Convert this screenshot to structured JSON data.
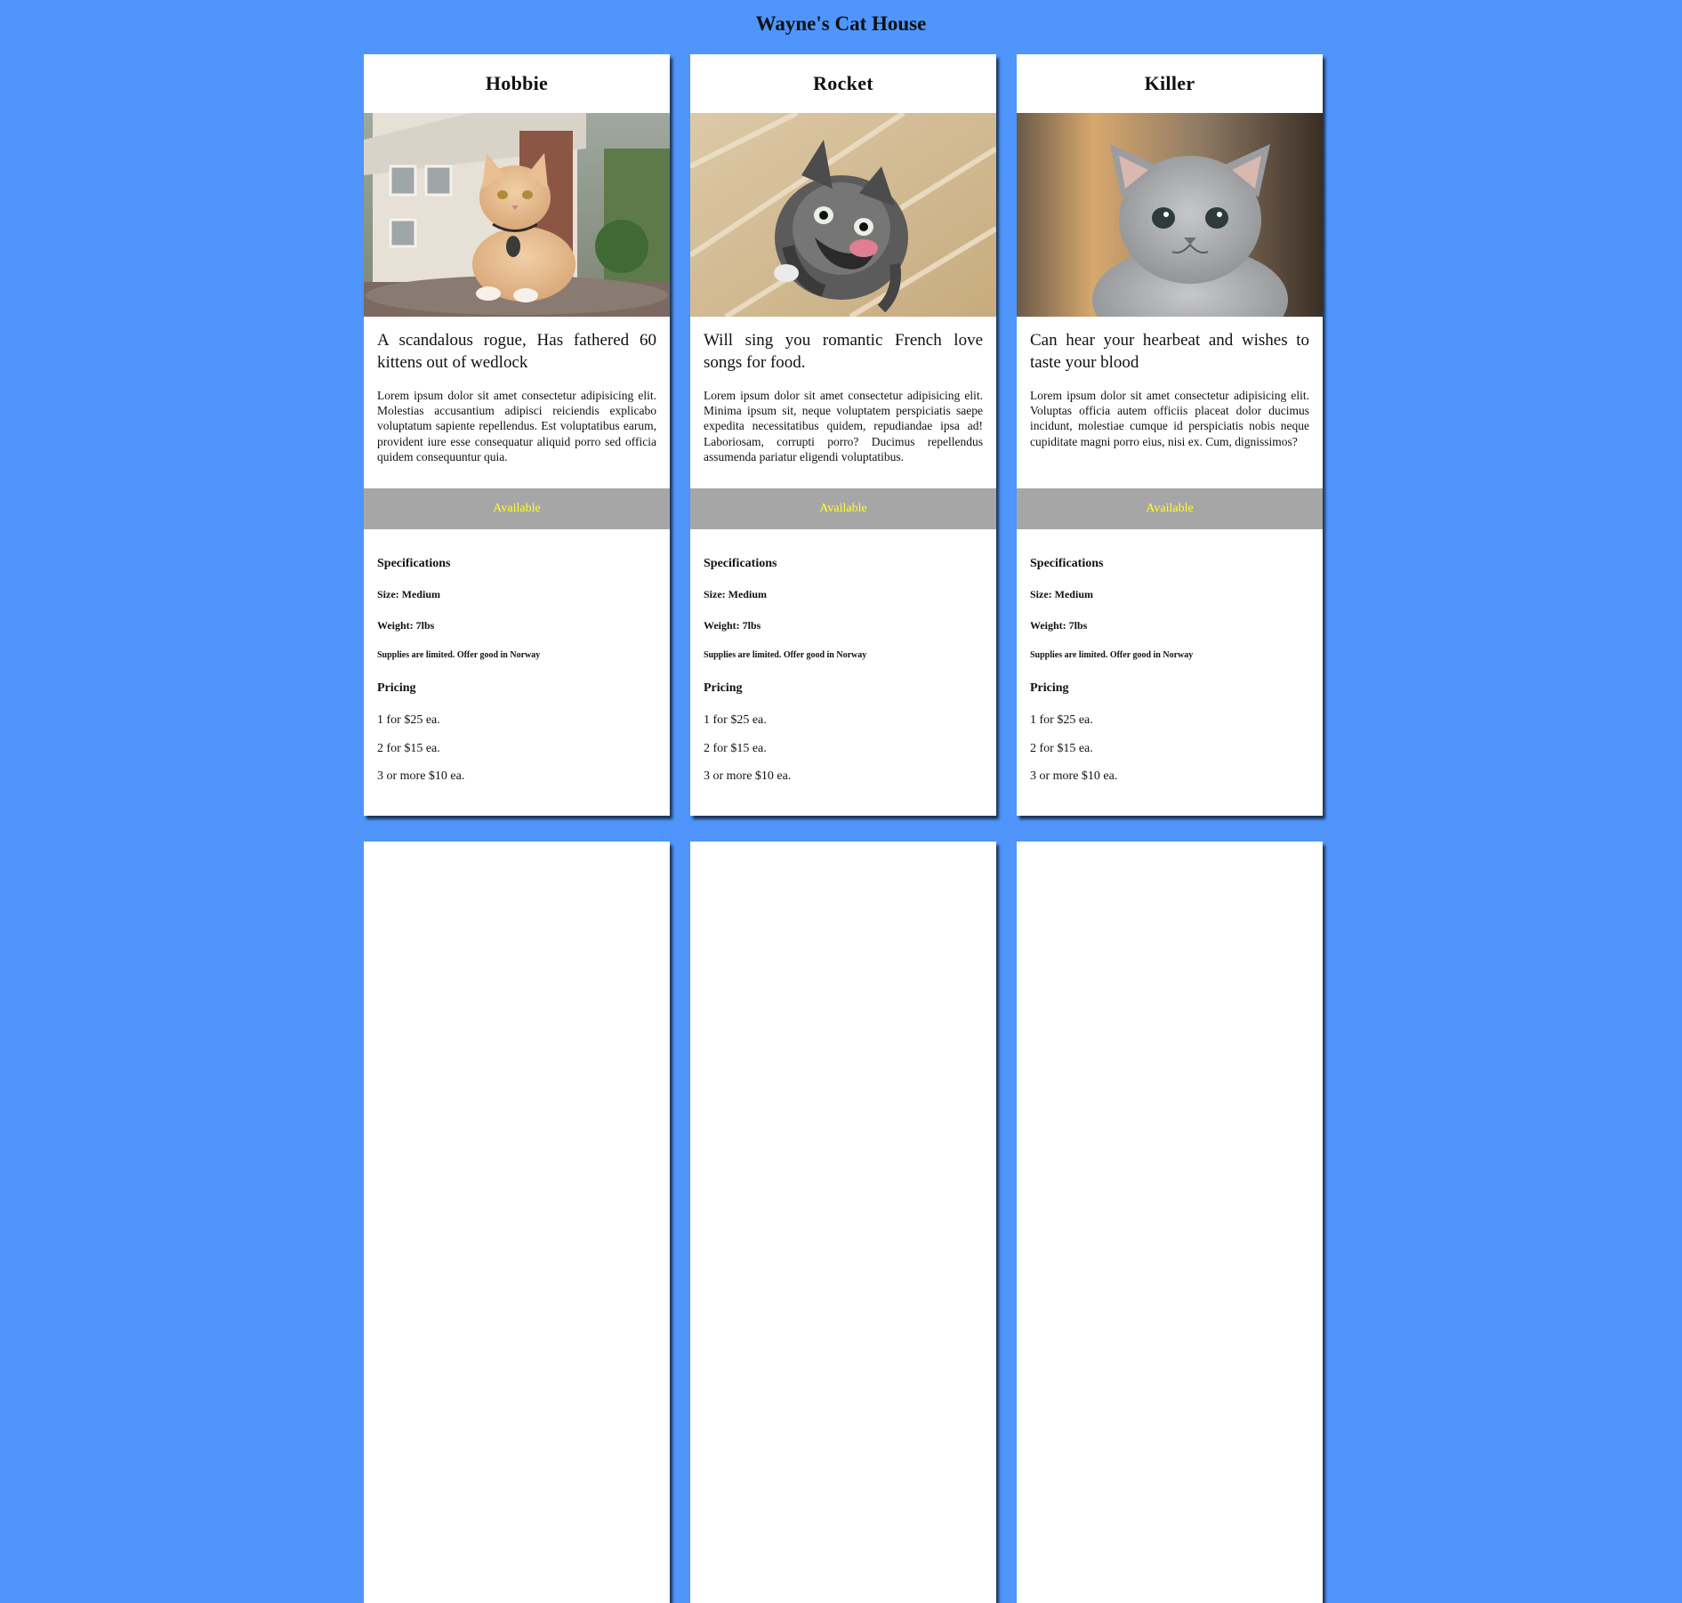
{
  "site": {
    "title": "Wayne's Cat House"
  },
  "labels": {
    "specifications": "Specifications",
    "pricing": "Pricing",
    "note": "Supplies are limited. Offer good in Norway"
  },
  "cats": [
    {
      "name": "Hobbie",
      "photo": "orange-tabby-cat-photo",
      "tagline": "A scandalous rogue, Has fathered 60 kittens out of wedlock",
      "blurb": "Lorem ipsum dolor sit amet consectetur adipisicing elit. Molestias accusantium adipisci reiciendis explicabo voluptatum sapiente repellendus. Est voluptatibus earum, provident iure esse consequatur aliquid porro sed officia quidem consequuntur quia.",
      "status": "Available",
      "size": "Size: Medium",
      "weight": "Weight: 7lbs",
      "prices": [
        "1 for $25 ea.",
        "2 for $15 ea.",
        "3 or more $10 ea."
      ]
    },
    {
      "name": "Rocket",
      "photo": "tabby-kitten-tongue-photo",
      "tagline": "Will sing you romantic French love songs for food.",
      "blurb": "Lorem ipsum dolor sit amet consectetur adipisicing elit. Minima ipsum sit, neque voluptatem perspiciatis saepe expedita necessitatibus quidem, repudiandae ipsa ad! Laboriosam, corrupti porro? Ducimus repellendus assumenda pariatur eligendi voluptatibus.",
      "status": "Available",
      "size": "Size: Medium",
      "weight": "Weight: 7lbs",
      "prices": [
        "1 for $25 ea.",
        "2 for $15 ea.",
        "3 or more $10 ea."
      ]
    },
    {
      "name": "Killer",
      "photo": "grey-kitten-photo",
      "tagline": "Can hear your hearbeat and wishes to taste your blood",
      "blurb": "Lorem ipsum dolor sit amet consectetur adipisicing elit. Voluptas officia autem officiis placeat dolor ducimus incidunt, molestiae cumque id perspiciatis nobis neque cupiditate magni porro eius, nisi ex. Cum, dignissimos?",
      "status": "Available",
      "size": "Size: Medium",
      "weight": "Weight: 7lbs",
      "prices": [
        "1 for $25 ea.",
        "2 for $15 ea.",
        "3 or more $10 ea."
      ]
    }
  ],
  "colors": {
    "background": "#4f95fb",
    "status_bar": "#a6a6a6",
    "status_text": "#ffff33"
  }
}
